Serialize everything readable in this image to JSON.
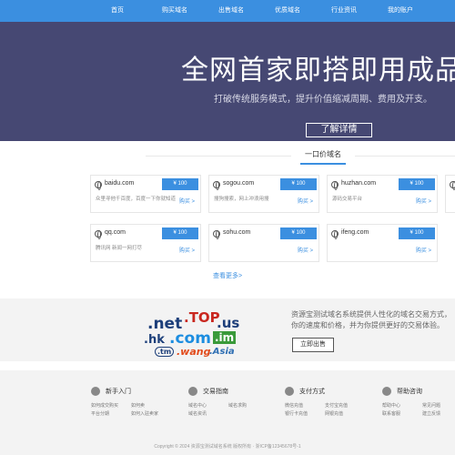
{
  "nav": {
    "items": [
      "首页",
      "购买域名",
      "出售域名",
      "优质域名",
      "行业资讯",
      "我的账户"
    ]
  },
  "hero": {
    "title": "全网首家即搭即用成品平",
    "subtitle": "打破传统服务模式，提升价值缩减周期、费用及开支。",
    "button": "了解详情"
  },
  "section": {
    "title": "一口价域名",
    "more": "查看更多>"
  },
  "cards": [
    {
      "domain": "baidu.com",
      "price": "¥ 100",
      "desc": "众里寻他千百度，百度一下你就知道",
      "buy": "购买 >"
    },
    {
      "domain": "sogou.com",
      "price": "¥ 100",
      "desc": "搜狗搜索，网上冲浪用搜",
      "buy": "购买 >"
    },
    {
      "domain": "huzhan.com",
      "price": "¥ 100",
      "desc": "源码交易平台",
      "buy": "购买 >"
    },
    {
      "domain": "qq.com",
      "price": "¥ 100",
      "desc": "腾讯网 新闻一网打尽",
      "buy": "购买 >"
    },
    {
      "domain": "sohu.com",
      "price": "¥ 100",
      "desc": "",
      "buy": "购买 >"
    },
    {
      "domain": "ifeng.com",
      "price": "¥ 100",
      "desc": "",
      "buy": "购买 >"
    }
  ],
  "promo": {
    "tlds": [
      ".net",
      ".TOP",
      ".us",
      ".hk",
      ".com",
      ".im",
      ".tm",
      ".wang",
      ".Asia"
    ],
    "text": "资源宝测试域名系统提供人性化的域名交易方式，你的速度和价格，并为你提供更好的交易体验。",
    "button": "立即出售"
  },
  "footer": {
    "columns": [
      {
        "title": "新手入门",
        "links": [
          "如何成交购买",
          "如何卖",
          "平台分期",
          "如何入驻卖家"
        ]
      },
      {
        "title": "交易指南",
        "links": [
          "域名中心",
          "域名求购",
          "域名资讯"
        ]
      },
      {
        "title": "支付方式",
        "links": [
          "微信充值",
          "支付宝充值",
          "银行卡充值",
          "网银充值"
        ]
      },
      {
        "title": "帮助咨询",
        "links": [
          "帮助中心",
          "常见问题",
          "联系客服",
          "建立反馈"
        ]
      }
    ],
    "copyright": "Copyright © 2024 资源宝测试域名系统 版权所有 · 浙ICP备12345678号-1"
  },
  "colors": {
    "accent": "#3b8fe0",
    "hero_bg": "#464873",
    "band_bg": "#f3f3f3"
  }
}
